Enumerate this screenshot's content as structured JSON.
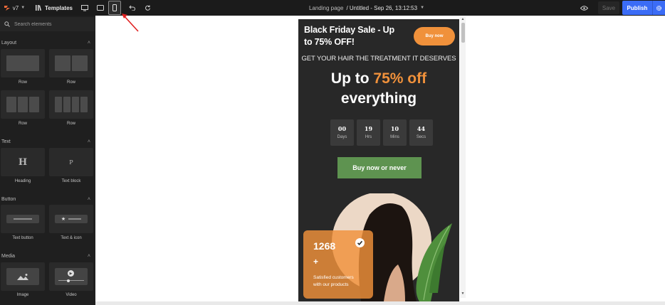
{
  "topbar": {
    "version": "v7",
    "templates_label": "Templates",
    "page_type": "Landing page",
    "doc_title": "/ Untitled - Sep 26, 13:12:53",
    "save_label": "Save",
    "publish_label": "Publish"
  },
  "sidebar": {
    "search_placeholder": "Search elements",
    "sections": {
      "layout": "Layout",
      "text": "Text",
      "button": "Button",
      "media": "Media"
    },
    "tiles": {
      "row1": "Row",
      "row2": "Row",
      "row3": "Row",
      "row4": "Row",
      "heading": "Heading",
      "heading_glyph": "H",
      "text_block": "Text block",
      "text_block_glyph": "P",
      "text_button": "Text button",
      "text_icon": "Text & icon",
      "image": "Image",
      "video": "Video"
    }
  },
  "preview": {
    "headline": "Black Friday Sale - Up to 75% OFF!",
    "buy_button": "Buy now",
    "tagline": "GET YOUR HAIR THE TREATMENT IT DESERVES",
    "big_prefix": "Up to ",
    "big_highlight": "75% off",
    "big_suffix": "everything",
    "countdown": [
      {
        "value": "00",
        "unit": "Days"
      },
      {
        "value": "19",
        "unit": "Hrs"
      },
      {
        "value": "10",
        "unit": "Mins"
      },
      {
        "value": "44",
        "unit": "Secs"
      }
    ],
    "cta_label": "Buy now or never",
    "stat_number": "1268",
    "stat_plus": "+",
    "stat_caption": "Satisfied customers with our products"
  },
  "colors": {
    "accent_orange": "#f0913b",
    "cta_green": "#5e9350",
    "publish_blue": "#3b6cf6",
    "preview_bg": "#282828",
    "annotation_arrow": "#e02020"
  }
}
